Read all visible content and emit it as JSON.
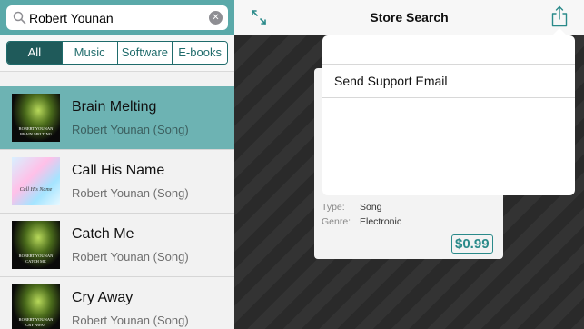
{
  "search": {
    "value": "Robert Younan"
  },
  "filters": [
    "All",
    "Music",
    "Software",
    "E-books"
  ],
  "results": [
    {
      "title": "Brain Melting",
      "subtitle": "Robert Younan (Song)",
      "art_caption": "ROBERT YOUNAN\nBRAIN MELTING",
      "art_style": "dark",
      "selected": true
    },
    {
      "title": "Call His Name",
      "subtitle": "Robert Younan (Song)",
      "art_caption": "Call His Name",
      "art_style": "light",
      "selected": false
    },
    {
      "title": "Catch Me",
      "subtitle": "Robert Younan (Song)",
      "art_caption": "ROBERT YOUNAN\nCATCH ME",
      "art_style": "dark",
      "selected": false
    },
    {
      "title": "Cry Away",
      "subtitle": "Robert Younan (Song)",
      "art_caption": "ROBERT YOUNAN\nCRY AWAY",
      "art_style": "dark",
      "selected": false
    }
  ],
  "navbar": {
    "title": "Store Search"
  },
  "detail": {
    "type_label": "Type:",
    "type_value": "Song",
    "genre_label": "Genre:",
    "genre_value": "Electronic",
    "price": "$0.99"
  },
  "popover": {
    "item": "Send Support Email"
  },
  "colors": {
    "accent": "#5aa9a9",
    "selected_row": "#6db3b3",
    "segment_active": "#1f5a5a"
  },
  "icons": {
    "search": "magnifier-icon",
    "clear": "clear-icon",
    "expand": "expand-icon",
    "share": "share-icon"
  }
}
